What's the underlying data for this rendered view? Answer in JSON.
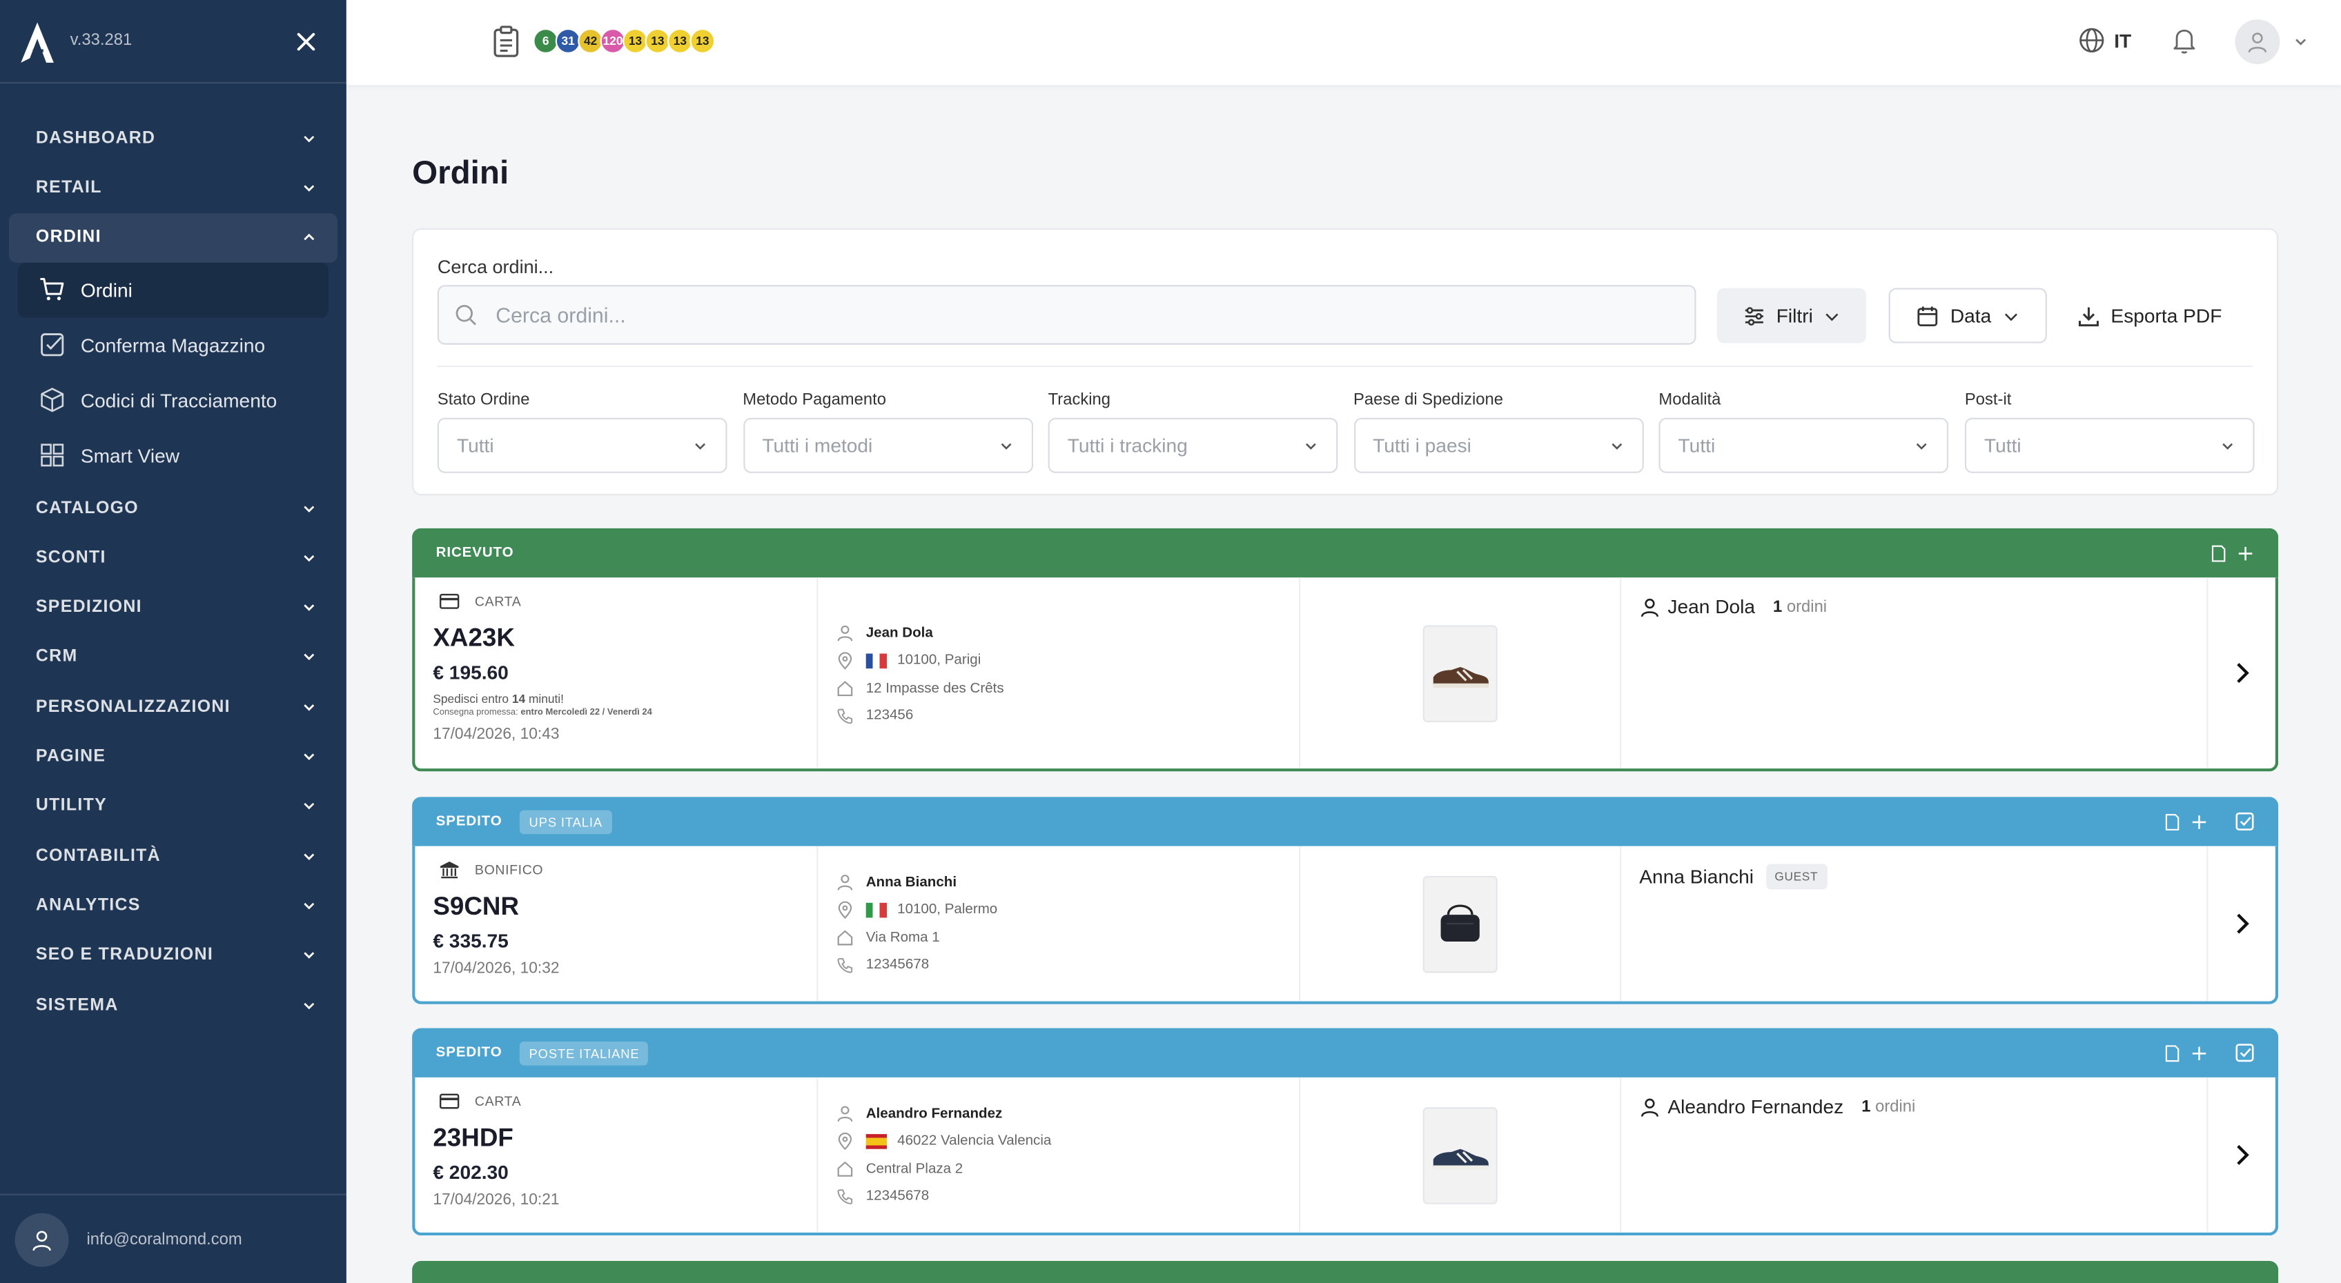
{
  "sidebar": {
    "version": "v.33.281",
    "sections": [
      {
        "label": "DASHBOARD",
        "open": false
      },
      {
        "label": "RETAIL",
        "open": false
      },
      {
        "label": "ORDINI",
        "open": true
      },
      {
        "label": "CATALOGO",
        "open": false
      },
      {
        "label": "SCONTI",
        "open": false
      },
      {
        "label": "SPEDIZIONI",
        "open": false
      },
      {
        "label": "CRM",
        "open": false
      },
      {
        "label": "PERSONALIZZAZIONI",
        "open": false
      },
      {
        "label": "PAGINE",
        "open": false
      },
      {
        "label": "UTILITY",
        "open": false
      },
      {
        "label": "CONTABILITÀ",
        "open": false
      },
      {
        "label": "ANALYTICS",
        "open": false
      },
      {
        "label": "SEO E TRADUZIONI",
        "open": false
      },
      {
        "label": "SISTEMA",
        "open": false
      }
    ],
    "sub_items": [
      {
        "label": "Ordini",
        "icon": "cart-icon",
        "active": true
      },
      {
        "label": "Conferma Magazzino",
        "icon": "check-square-icon",
        "active": false
      },
      {
        "label": "Codici di Tracciamento",
        "icon": "box-icon",
        "active": false
      },
      {
        "label": "Smart View",
        "icon": "grid-icon",
        "active": false
      }
    ],
    "user_email": "info@coralmond.com"
  },
  "topbar": {
    "badges": [
      {
        "value": "6",
        "color": "#3a8a4a"
      },
      {
        "value": "31",
        "color": "#2e5aa8"
      },
      {
        "value": "42",
        "color": "#e6c22c"
      },
      {
        "value": "120",
        "color": "#d85aa8"
      },
      {
        "value": "13",
        "color": "#f0d030"
      },
      {
        "value": "13",
        "color": "#f0d030"
      },
      {
        "value": "13",
        "color": "#f0d030"
      },
      {
        "value": "13",
        "color": "#f0d030"
      }
    ],
    "language": "IT"
  },
  "page": {
    "title": "Ordini"
  },
  "filters": {
    "search_label": "Cerca ordini...",
    "search_placeholder": "Cerca ordini...",
    "btn_filtri": "Filtri",
    "btn_data": "Data",
    "btn_pdf": "Esporta PDF",
    "selects": [
      {
        "label": "Stato Ordine",
        "value": "Tutti"
      },
      {
        "label": "Metodo Pagamento",
        "value": "Tutti i metodi"
      },
      {
        "label": "Tracking",
        "value": "Tutti i tracking"
      },
      {
        "label": "Paese di Spedizione",
        "value": "Tutti i paesi"
      },
      {
        "label": "Modalità",
        "value": "Tutti"
      },
      {
        "label": "Post-it",
        "value": "Tutti"
      }
    ]
  },
  "orders": [
    {
      "status": "RICEVUTO",
      "status_color": "#3f8a55",
      "carrier": "",
      "payment": "CARTA",
      "code": "XA23K",
      "price": "€ 195.60",
      "ship_prefix": "Spedisci entro",
      "ship_minutes": "14",
      "ship_suffix": "minuti!",
      "delivery_prefix": "Consegna promessa:",
      "delivery_value": "entro Mercoledì 22 / Venerdì 24",
      "date": "17/04/2026, 10:43",
      "name": "Jean Dola",
      "city": "10100, Parigi",
      "country": "FR",
      "address": "12 Impasse des Crêts",
      "phone": "123456",
      "customer": "Jean Dola",
      "orders_count": "1",
      "orders_label": "ordini",
      "guest": ""
    },
    {
      "status": "SPEDITO",
      "status_color": "#4ba3d0",
      "carrier": "UPS ITALIA",
      "payment": "BONIFICO",
      "code": "S9CNR",
      "price": "€ 335.75",
      "date": "17/04/2026, 10:32",
      "name": "Anna Bianchi",
      "city": "10100, Palermo",
      "country": "IT",
      "address": "Via Roma 1",
      "phone": "12345678",
      "customer": "Anna Bianchi",
      "guest": "GUEST"
    },
    {
      "status": "SPEDITO",
      "status_color": "#4ba3d0",
      "carrier": "POSTE ITALIANE",
      "payment": "CARTA",
      "code": "23HDF",
      "price": "€ 202.30",
      "date": "17/04/2026, 10:21",
      "name": "Aleandro Fernandez",
      "city": "46022 Valencia Valencia",
      "country": "ES",
      "address": "Central Plaza 2",
      "phone": "12345678",
      "customer": "Aleandro Fernandez",
      "orders_count": "1",
      "orders_label": "ordini",
      "guest": ""
    }
  ]
}
